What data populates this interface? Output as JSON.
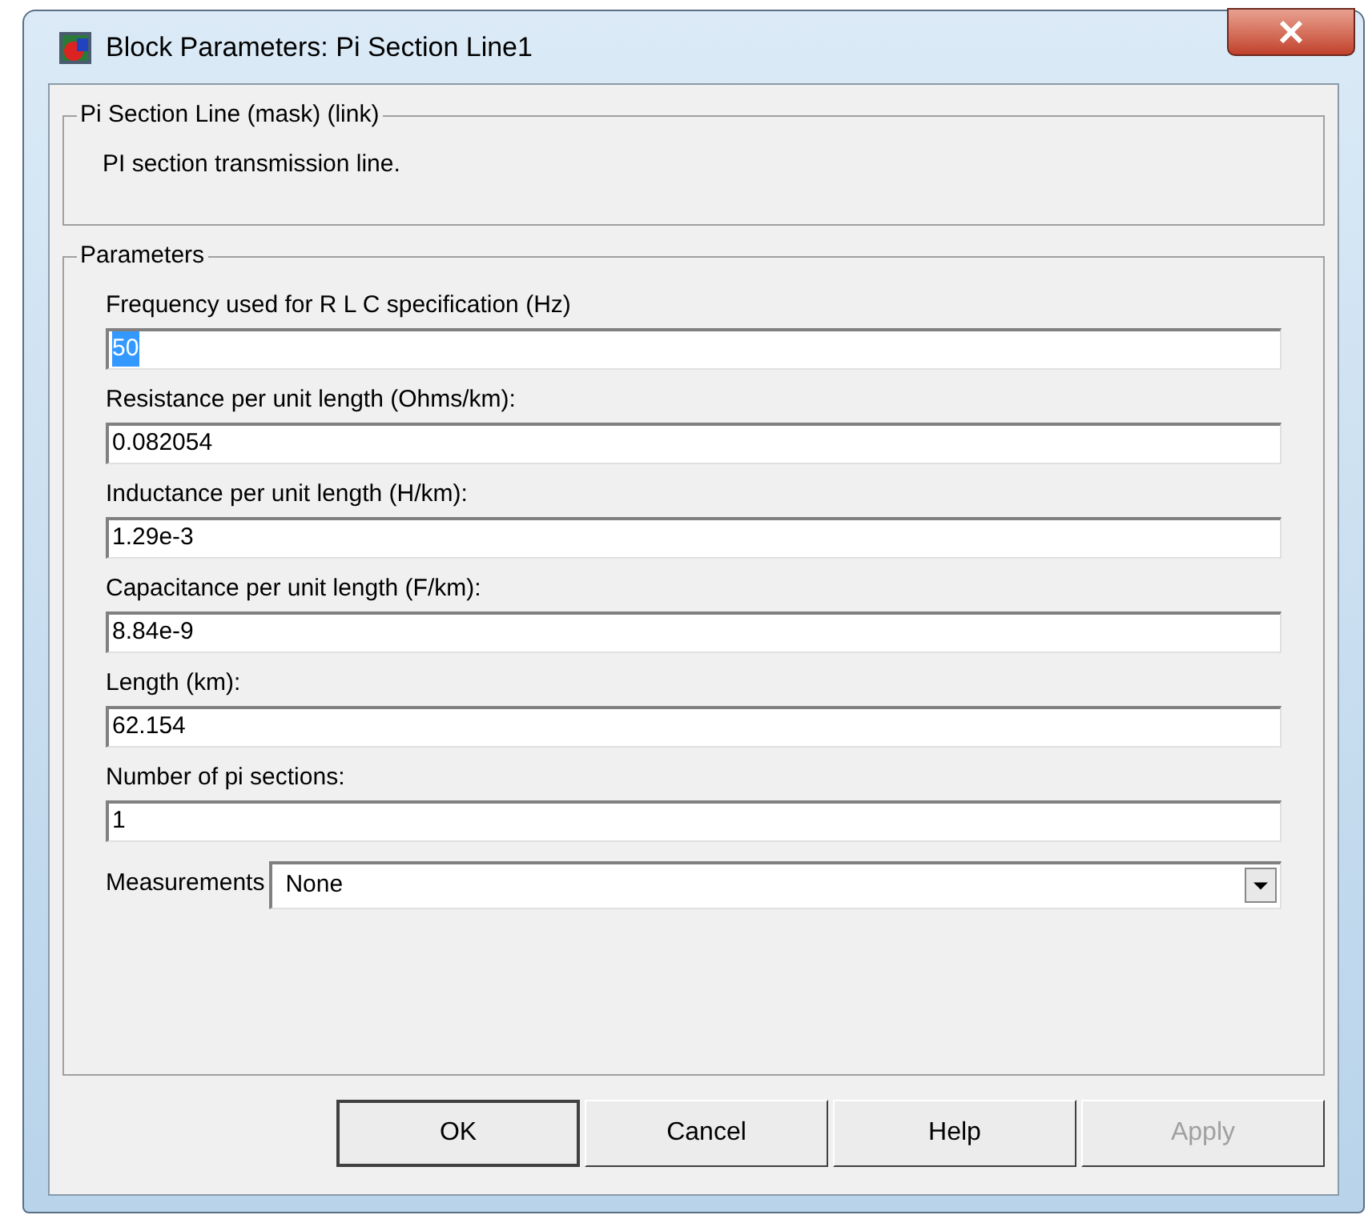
{
  "window": {
    "title": "Block Parameters: Pi Section Line1"
  },
  "description_group": {
    "title": "Pi Section Line (mask) (link)",
    "text": "PI section transmission line."
  },
  "parameters": {
    "title": "Parameters",
    "fields": [
      {
        "label": "Frequency used for R L C specification (Hz)",
        "value": "50",
        "text_selected": true
      },
      {
        "label": "Resistance per unit length (Ohms/km):",
        "value": "0.082054",
        "text_selected": false
      },
      {
        "label": "Inductance per unit length (H/km):",
        "value": "1.29e-3",
        "text_selected": false
      },
      {
        "label": "Capacitance per unit length (F/km):",
        "value": "8.84e-9",
        "text_selected": false
      },
      {
        "label": "Length (km):",
        "value": "62.154",
        "text_selected": false
      },
      {
        "label": "Number of pi sections:",
        "value": "1",
        "text_selected": false
      }
    ],
    "measurements": {
      "label": "Measurements",
      "value": "None"
    }
  },
  "buttons": [
    {
      "label": "OK",
      "default": true,
      "disabled": false
    },
    {
      "label": "Cancel",
      "default": false,
      "disabled": false
    },
    {
      "label": "Help",
      "default": false,
      "disabled": false
    },
    {
      "label": "Apply",
      "default": false,
      "disabled": true
    }
  ]
}
